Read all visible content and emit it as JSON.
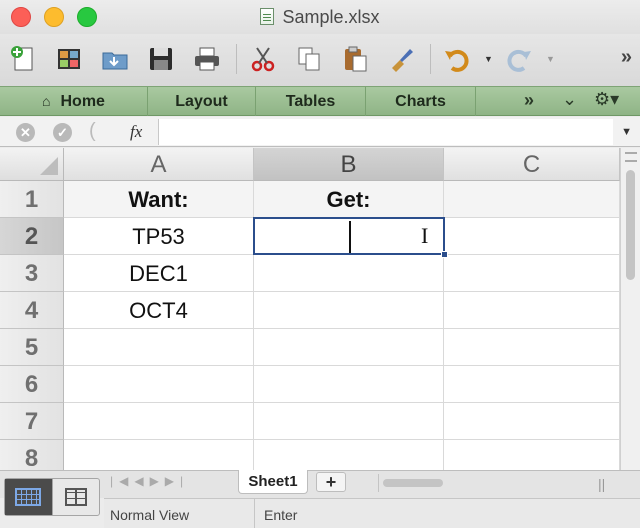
{
  "window": {
    "title": "Sample.xlsx"
  },
  "toolbar": {
    "buttons": [
      "new-document",
      "template-gallery",
      "open",
      "save",
      "print",
      "cut",
      "copy",
      "paste",
      "format-painter",
      "undo",
      "redo"
    ]
  },
  "ribbon": {
    "tabs": [
      {
        "label": "Home",
        "icon": "home-icon"
      },
      {
        "label": "Layout"
      },
      {
        "label": "Tables"
      },
      {
        "label": "Charts"
      }
    ],
    "more": "»"
  },
  "formula_bar": {
    "fx": "fx",
    "value": ""
  },
  "grid": {
    "columns": [
      "A",
      "B",
      "C"
    ],
    "selected_column": "B",
    "rows": [
      {
        "num": "1",
        "A": "Want:",
        "B": "Get:",
        "C": ""
      },
      {
        "num": "2",
        "A": "TP53",
        "B": "",
        "C": ""
      },
      {
        "num": "3",
        "A": "DEC1",
        "B": "",
        "C": ""
      },
      {
        "num": "4",
        "A": "OCT4",
        "B": "",
        "C": ""
      },
      {
        "num": "5",
        "A": "",
        "B": "",
        "C": ""
      },
      {
        "num": "6",
        "A": "",
        "B": "",
        "C": ""
      },
      {
        "num": "7",
        "A": "",
        "B": "",
        "C": ""
      },
      {
        "num": "8",
        "A": "",
        "B": "",
        "C": ""
      }
    ],
    "active_cell": "B2"
  },
  "sheets": {
    "tabs": [
      "Sheet1"
    ],
    "add": "+"
  },
  "status": {
    "view": "Normal View",
    "mode": "Enter"
  },
  "colors": {
    "ribbon": "#9dbf94",
    "selection": "#2b4e8c"
  }
}
